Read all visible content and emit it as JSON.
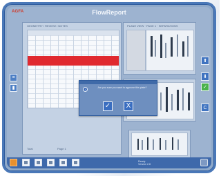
{
  "header": {
    "brand": "AGFA",
    "title": "FlowReport"
  },
  "sheet": {
    "top_label": "GEOMETRY / REVIEW / NOTES",
    "foot_left": "Total",
    "foot_right": "Page 1"
  },
  "thumbnails": {
    "panel1_label": "PLANE VIEW · PAGE 1 · SEPARATIONS"
  },
  "dialog": {
    "message": "Are you sure you want to approve this plate?",
    "confirm_glyph": "✓",
    "cancel_glyph": "X"
  },
  "right_tools": {
    "up_glyph": "⬆",
    "down_glyph": "⬇",
    "approve_glyph": "✓",
    "back_glyph": "C"
  },
  "left_tools": {
    "top_glyph": "≡",
    "bottom_glyph": "▮"
  },
  "bottom_bar": {
    "status_line1": "Ready",
    "status_line2": "Version 2.8"
  },
  "colors": {
    "accent": "#4a78b8",
    "highlight_row": "#e0292f",
    "approve": "#49b24a",
    "home": "#e8902e"
  }
}
